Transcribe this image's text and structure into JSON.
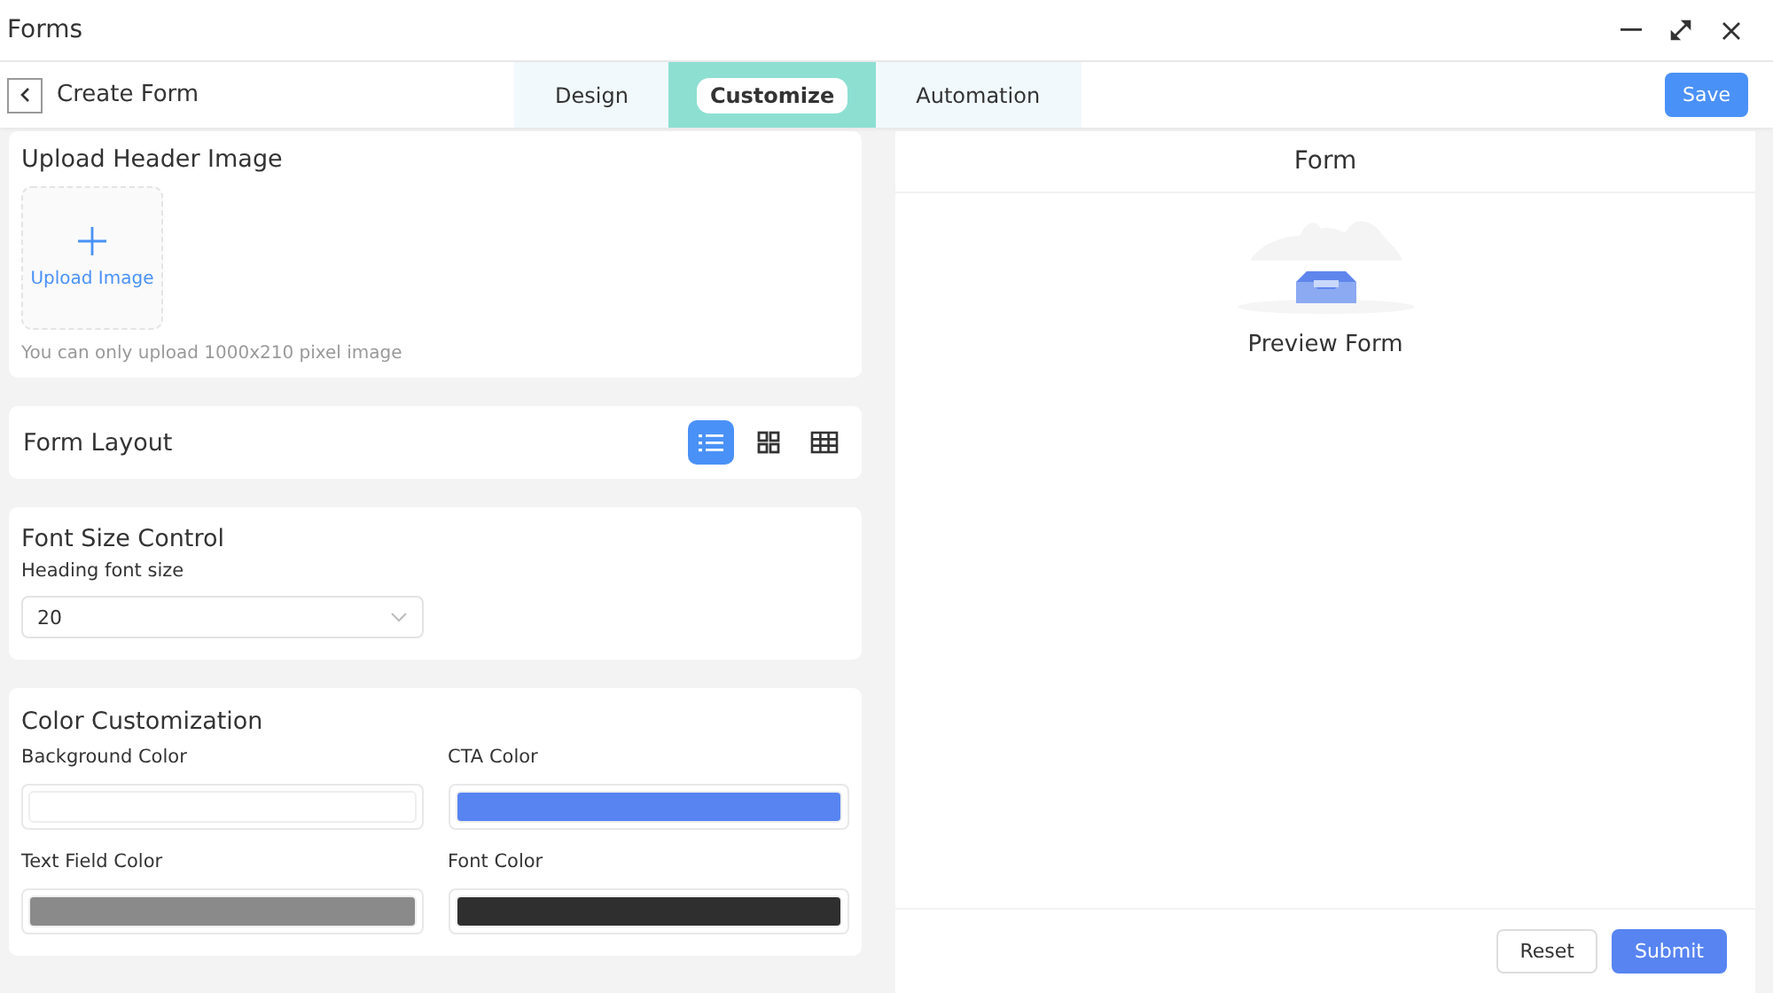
{
  "window": {
    "title": "Forms"
  },
  "header": {
    "back": "Create Form",
    "save": "Save"
  },
  "tabs": [
    {
      "label": "Design",
      "selected": false
    },
    {
      "label": "Customize",
      "selected": true
    },
    {
      "label": "Automation",
      "selected": false
    }
  ],
  "upload": {
    "title": "Upload Header Image",
    "button": "Upload Image",
    "hint": "You can only upload 1000x210 pixel image"
  },
  "layout": {
    "title": "Form Layout",
    "options": [
      {
        "kind": "list",
        "selected": true
      },
      {
        "kind": "grid",
        "selected": false
      },
      {
        "kind": "table",
        "selected": false
      }
    ]
  },
  "font_size": {
    "title": "Font Size Control",
    "label": "Heading font size",
    "value": "20"
  },
  "colors": {
    "title": "Color Customization",
    "items": [
      {
        "label": "Background Color",
        "color": "#ffffff"
      },
      {
        "label": "CTA Color",
        "color": "#5784f1"
      },
      {
        "label": "Text Field Color",
        "color": "#8a8a8a"
      },
      {
        "label": "Font Color",
        "color": "#2f2f2f"
      }
    ]
  },
  "preview": {
    "title": "Form",
    "empty": "Preview Form",
    "buttons": [
      {
        "label": "Reset",
        "kind": "default"
      },
      {
        "label": "Submit",
        "kind": "primary"
      }
    ]
  }
}
